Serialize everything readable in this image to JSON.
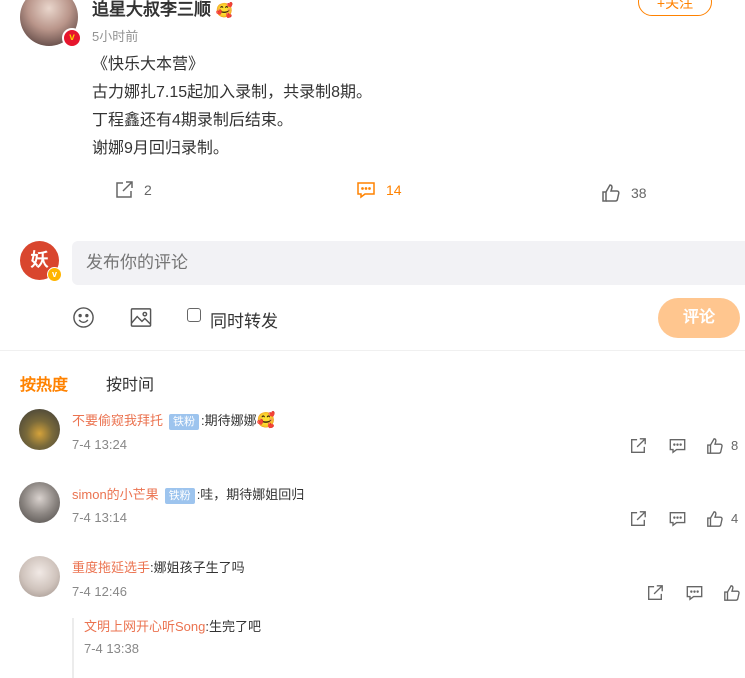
{
  "post": {
    "author": "追星大叔李三顺",
    "author_emoji": "🥰",
    "time": "5小时前",
    "follow_label": "+关注",
    "lines": [
      "《快乐大本营》",
      "古力娜扎7.15起加入录制，共录制8期。",
      "丁程鑫还有4期录制后结束。",
      "谢娜9月回归录制。"
    ],
    "actions": {
      "share_count": "2",
      "comment_count": "14",
      "like_count": "38"
    }
  },
  "compose": {
    "placeholder": "发布你的评论",
    "repost_label": "同时转发",
    "submit_label": "评论"
  },
  "sort": {
    "hot": "按热度",
    "time": "按时间"
  },
  "comments": [
    {
      "name": "不要偷窥我拜托",
      "badge": "铁粉",
      "text": ":期待娜娜",
      "emoji": "🥰",
      "time": "7-4 13:24",
      "like_partial": "8"
    },
    {
      "name": "simon的小芒果",
      "badge": "铁粉",
      "text": ":哇，期待娜姐回归",
      "time": "7-4 13:14",
      "like_partial": "4"
    },
    {
      "name": "重度拖延选手",
      "text": ":娜姐孩子生了吗",
      "time": "7-4 12:46"
    }
  ],
  "reply": {
    "name": "文明上网开心听Song",
    "text": ":生完了吧",
    "time": "7-4 13:38"
  },
  "colors": {
    "accent": "#ff8200",
    "name": "#eb7350",
    "badge": "#9dc4ee",
    "submit": "#ffc68f"
  }
}
